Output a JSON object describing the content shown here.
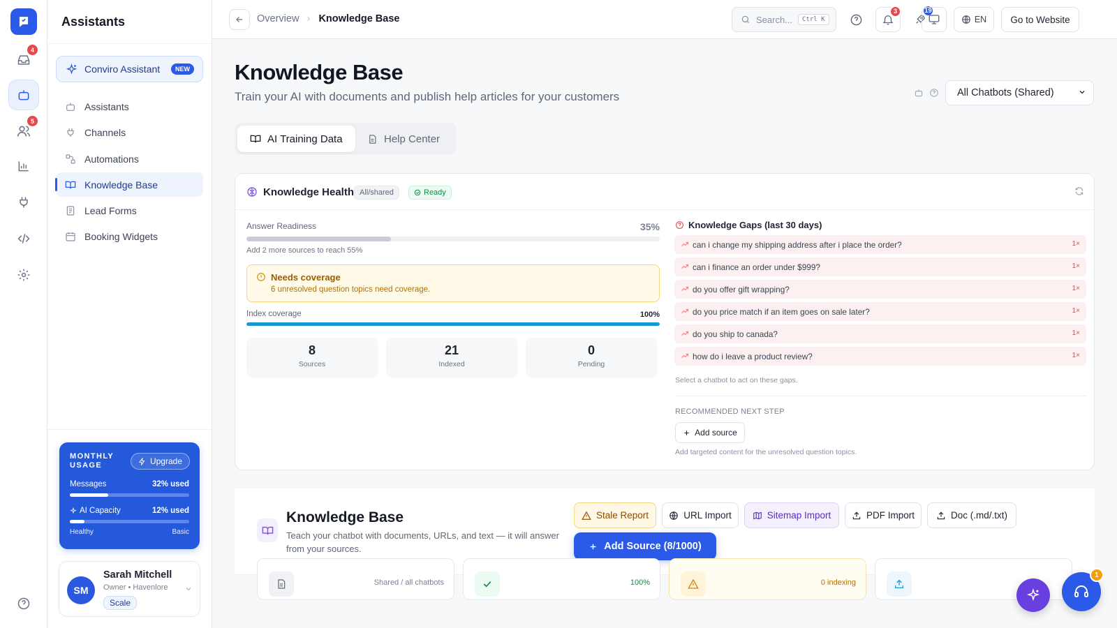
{
  "rail": {
    "inbox_badge": "4",
    "contacts_badge": "5"
  },
  "sidebar": {
    "title": "Assistants",
    "promo": {
      "label": "Conviro Assistant",
      "badge": "NEW"
    },
    "items": [
      {
        "label": "Assistants"
      },
      {
        "label": "Channels"
      },
      {
        "label": "Automations"
      },
      {
        "label": "Knowledge Base"
      },
      {
        "label": "Lead Forms"
      },
      {
        "label": "Booking Widgets"
      }
    ],
    "usage": {
      "title": "MONTHLY USAGE",
      "upgrade": "Upgrade",
      "messages_label": "Messages",
      "messages_value": "32% used",
      "messages_fraction": 0.32,
      "ai_label": "AI Capacity",
      "ai_value": "12% used",
      "ai_fraction": 0.12,
      "status_left": "Healthy",
      "status_right": "Basic"
    },
    "user": {
      "initials": "SM",
      "name": "Sarah Mitchell",
      "role": "Owner • Havenlore",
      "plan": "Scale"
    }
  },
  "topbar": {
    "crumb_parent": "Overview",
    "crumb_current": "Knowledge Base",
    "search_placeholder": "Search...",
    "search_shortcut": "Ctrl K",
    "notifications_count": "3",
    "updates_count": "19",
    "language": "EN",
    "go_website": "Go to Website"
  },
  "page": {
    "title": "Knowledge Base",
    "subtitle": "Train your AI with documents and publish help articles for your customers",
    "chatbot_select": "All Chatbots (Shared)",
    "tabs": [
      "AI Training Data",
      "Help Center"
    ]
  },
  "health": {
    "title": "Knowledge Health",
    "scope_badge": "All/shared",
    "status_badge": "Ready",
    "answer_readiness_label": "Answer Readiness",
    "answer_readiness_value": "35%",
    "answer_readiness_fraction": 0.35,
    "readiness_hint": "Add 2 more sources to reach 55%",
    "warning_title": "Needs coverage",
    "warning_text": "6 unresolved question topics need coverage.",
    "index_label": "Index coverage",
    "index_value": "100%",
    "index_fraction": 1.0,
    "stats": [
      {
        "value": "8",
        "label": "Sources"
      },
      {
        "value": "21",
        "label": "Indexed"
      },
      {
        "value": "0",
        "label": "Pending"
      }
    ],
    "gaps_title": "Knowledge Gaps (last 30 days)",
    "gaps": [
      {
        "q": "can i change my shipping address after i place the order?",
        "count": "1×"
      },
      {
        "q": "can i finance an order under $999?",
        "count": "1×"
      },
      {
        "q": "do you offer gift wrapping?",
        "count": "1×"
      },
      {
        "q": "do you price match if an item goes on sale later?",
        "count": "1×"
      },
      {
        "q": "do you ship to canada?",
        "count": "1×"
      },
      {
        "q": "how do i leave a product review?",
        "count": "1×"
      }
    ],
    "gaps_hint": "Select a chatbot to act on these gaps.",
    "recommended_label": "RECOMMENDED NEXT STEP",
    "add_source": "Add source",
    "recommended_hint": "Add targeted content for the unresolved question topics."
  },
  "kb": {
    "title": "Knowledge Base",
    "subtitle": "Teach your chatbot with documents, URLs, and text — it will answer from your sources.",
    "actions": [
      "Stale Report",
      "URL Import",
      "Sitemap Import",
      "PDF Import",
      "Doc (.md/.txt)"
    ],
    "primary": "Add Source (8/1000)"
  },
  "cards": [
    {
      "tag": "Shared / all chatbots"
    },
    {
      "tag": "100%"
    },
    {
      "tag": "0 indexing"
    },
    {
      "tag": ""
    }
  ],
  "support_badge": "1",
  "colors": {
    "brand": "#2b59e8",
    "danger": "#e5484d",
    "success": "#14874a",
    "warning": "#c98a0a",
    "purple": "#7c4ddb"
  }
}
